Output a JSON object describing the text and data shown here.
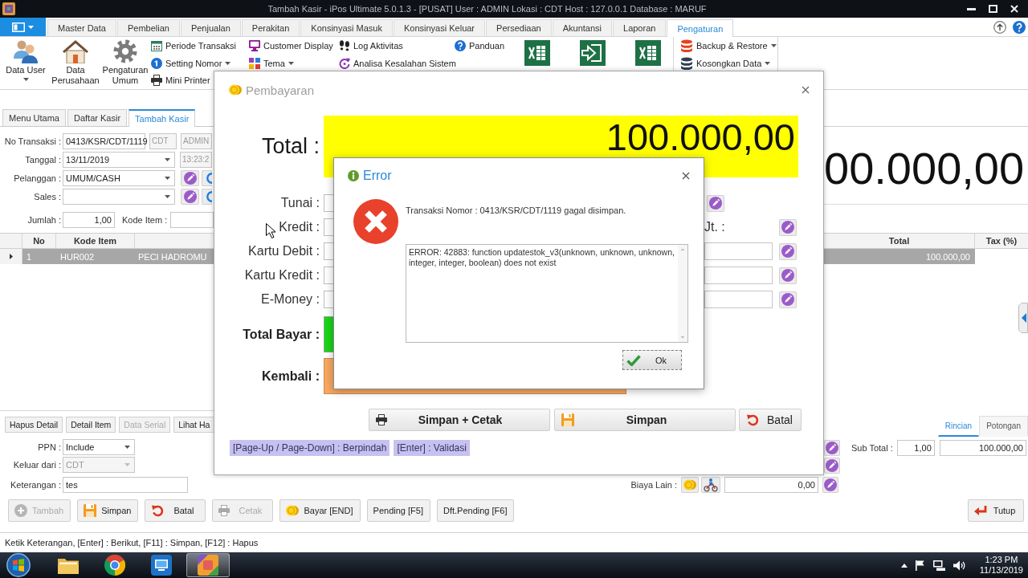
{
  "window": {
    "title": "Tambah Kasir - iPos Ultimate 5.0.1.3 - [PUSAT] User : ADMIN Lokasi : CDT Host : 127.0.0.1 Database : MARUF"
  },
  "ribbon": {
    "tabs": [
      {
        "label": "Master Data",
        "selected": false
      },
      {
        "label": "Pembelian",
        "selected": false
      },
      {
        "label": "Penjualan",
        "selected": false
      },
      {
        "label": "Perakitan",
        "selected": false
      },
      {
        "label": "Konsinyasi Masuk",
        "selected": false
      },
      {
        "label": "Konsinyasi Keluar",
        "selected": false
      },
      {
        "label": "Persediaan",
        "selected": false
      },
      {
        "label": "Akuntansi",
        "selected": false
      },
      {
        "label": "Laporan",
        "selected": false
      },
      {
        "label": "Pengaturan",
        "selected": true
      }
    ],
    "large_buttons": [
      {
        "label": "Data User",
        "dropdown": true
      },
      {
        "label": "Data Perusahaan",
        "dropdown": false
      },
      {
        "label": "Pengaturan Umum",
        "dropdown": false
      }
    ],
    "small_button_columns": [
      {
        "items": [
          {
            "label": "Periode Transaksi",
            "dropdown": false
          },
          {
            "label": "Setting Nomor",
            "dropdown": true
          },
          {
            "label": "Mini Printer",
            "dropdown": false
          }
        ]
      },
      {
        "items": [
          {
            "label": "Customer Display",
            "dropdown": false
          },
          {
            "label": "Tema",
            "dropdown": true
          }
        ]
      },
      {
        "items": [
          {
            "label": "Log Aktivitas",
            "dropdown": false
          },
          {
            "label": "Analisa Kesalahan Sistem",
            "dropdown": false
          }
        ]
      },
      {
        "items": [
          {
            "label": "Panduan",
            "dropdown": false
          }
        ]
      }
    ],
    "data_buttons": [
      {
        "label": "Backup & Restore",
        "dropdown": true
      },
      {
        "label": "Kosongkan Data",
        "dropdown": true
      }
    ]
  },
  "document_tabs": [
    {
      "label": "Menu Utama",
      "selected": false
    },
    {
      "label": "Daftar Kasir",
      "selected": false
    },
    {
      "label": "Tambah Kasir",
      "selected": true
    }
  ],
  "form": {
    "no_transaksi": {
      "label": "No Transaksi :",
      "value": "0413/KSR/CDT/1119",
      "location": {
        "value": "CDT",
        "disabled": true
      },
      "user": {
        "value": "ADMIN",
        "disabled": true
      }
    },
    "tanggal": {
      "label": "Tanggal :",
      "value": "13/11/2019",
      "time": {
        "value": "13:23:2",
        "disabled": true
      }
    },
    "pelanggan": {
      "label": "Pelanggan :",
      "value": "UMUM/CASH"
    },
    "sales": {
      "label": "Sales :"
    },
    "jumlah": {
      "label": "Jumlah :",
      "value": "1,00"
    },
    "kode_item": {
      "label": "Kode Item :"
    }
  },
  "total_display": {
    "value": "00.000,00"
  },
  "table": {
    "columns": [
      {
        "label": "No"
      },
      {
        "label": "Kode Item"
      },
      {
        "label": "Total"
      },
      {
        "label": "Tax (%)"
      }
    ],
    "rows": [
      {
        "selected": true,
        "no": "1",
        "kode_item": "HUR002",
        "column_3": "PECI HADROMU",
        "total": "100.000,00"
      }
    ]
  },
  "detail_buttons": [
    {
      "label": "Hapus Detail",
      "disabled": false
    },
    {
      "label": "Detail Item",
      "disabled": false
    },
    {
      "label": "Data Serial",
      "disabled": true
    },
    {
      "label": "Lihat Ha",
      "disabled": false
    }
  ],
  "options": {
    "ppn": {
      "label": "PPN :",
      "value": "Include",
      "disabled": false
    },
    "keluar_dari": {
      "label": "Keluar dari :",
      "value": "CDT",
      "disabled": true
    },
    "keterangan": {
      "label": "Keterangan :",
      "value": "tes"
    }
  },
  "summary_tabs": [
    {
      "label": "Rincian",
      "selected": true
    },
    {
      "label": "Potongan",
      "selected": false
    }
  ],
  "sub_total": {
    "label": "Sub Total :",
    "quantity": "1,00",
    "amount": "100.000,00"
  },
  "biaya_lain": {
    "label": "Biaya Lain :",
    "value": "0,00"
  },
  "actions": [
    {
      "label": "Tambah",
      "disabled": true
    },
    {
      "label": "Simpan",
      "disabled": false
    },
    {
      "label": "Batal",
      "disabled": false
    },
    {
      "label": "Cetak",
      "disabled": true
    },
    {
      "label": "Bayar [END]",
      "disabled": false
    },
    {
      "label": "Pending [F5]",
      "disabled": false
    },
    {
      "label": "Dft.Pending [F6]",
      "disabled": false
    },
    {
      "label": "Tutup",
      "disabled": false
    }
  ],
  "status_bar": {
    "text": "Ketik Keterangan, [Enter] : Berikut, [F11] : Simpan, [F12] : Hapus"
  },
  "payment_dialog": {
    "title": "Pembayaran",
    "total": {
      "label": "Total :",
      "value": "100.000,00"
    },
    "methods": [
      {
        "label": "Tunai :"
      },
      {
        "label": "Kredit :"
      },
      {
        "label": "Kartu Debit :"
      },
      {
        "label": "Kartu Kredit :"
      },
      {
        "label": "E-Money :"
      }
    ],
    "side_column": [
      {
        "kind": "button"
      },
      {
        "kind": "label",
        "label": "Jt. :"
      },
      {
        "kind": "field"
      },
      {
        "kind": "field"
      },
      {
        "kind": "field"
      }
    ],
    "total_bayar": {
      "label": "Total Bayar :"
    },
    "kembali": {
      "label": "Kembali :"
    },
    "buttons": [
      {
        "label": "Simpan + Cetak"
      },
      {
        "label": "Simpan"
      },
      {
        "label": "Batal"
      }
    ],
    "hints": [
      "[Page-Up / Page-Down] : Berpindah",
      "[Enter] : Validasi"
    ]
  },
  "error_dialog": {
    "title": "Error",
    "message": "Transaksi Nomor : 0413/KSR/CDT/1119 gagal disimpan.",
    "details": "ERROR: 42883: function updatestok_v3(unknown, unknown, unknown, integer, integer, boolean) does not exist",
    "button": "Ok"
  },
  "taskbar": {
    "apps": [
      {
        "selected": false
      },
      {
        "selected": false
      },
      {
        "selected": false
      },
      {
        "selected": true
      }
    ],
    "clock": {
      "time": "1:23 PM",
      "date": "11/13/2019"
    }
  }
}
